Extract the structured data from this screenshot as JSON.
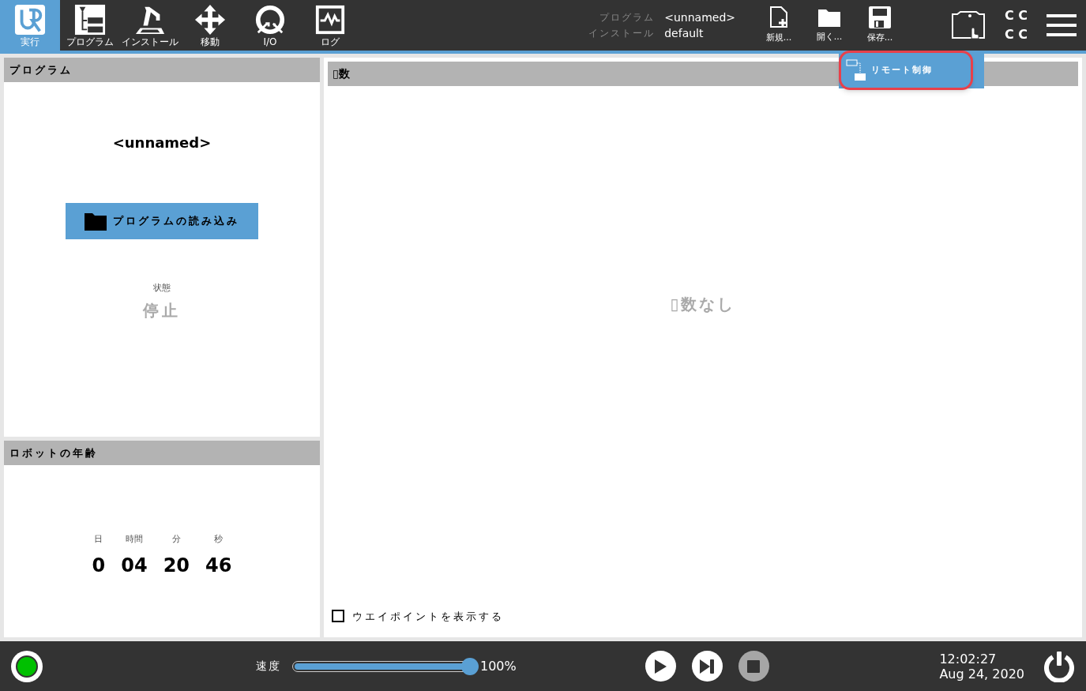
{
  "nav": [
    {
      "kind": "logo",
      "label": "実行",
      "selected": true
    },
    {
      "kind": "program",
      "label": "プログラム",
      "selected": false
    },
    {
      "kind": "arm",
      "label": "インストール",
      "selected": false
    },
    {
      "kind": "move",
      "label": "移動",
      "selected": false
    },
    {
      "kind": "io",
      "label": "I/O",
      "selected": false
    },
    {
      "kind": "log",
      "label": "ログ",
      "selected": false
    }
  ],
  "program_info": {
    "program_label": "プログラム",
    "program_value": "<unnamed>",
    "installation_label": "インストール",
    "installation_value": "default"
  },
  "file_buttons": [
    {
      "kind": "new",
      "label": "新規..."
    },
    {
      "kind": "open",
      "label": "開く..."
    },
    {
      "kind": "save",
      "label": "保存..."
    }
  ],
  "remote_menu": {
    "label": "リモート制御"
  },
  "top_right_text": [
    "C C",
    "C C"
  ],
  "program_panel": {
    "title": "プログラム",
    "name": "<unnamed>",
    "load_button": "プログラムの読み込み",
    "status_label": "状態",
    "status_value": "停止"
  },
  "age_panel": {
    "title": "ロボットの年齢",
    "units": [
      {
        "label": "日",
        "value": "0"
      },
      {
        "label": "時間",
        "value": "04"
      },
      {
        "label": "分",
        "value": "20"
      },
      {
        "label": "秒",
        "value": "46"
      }
    ]
  },
  "variables_panel": {
    "title": "▯数",
    "empty_text": "▯数なし",
    "show_waypoints": {
      "label": "ウエイポイントを表示する",
      "checked": false
    }
  },
  "bottom": {
    "speed_label": "速度",
    "speed": {
      "level": 1
    },
    "speed_reading": "100%",
    "controls": [
      {
        "kind": "play",
        "disabled": false
      },
      {
        "kind": "step",
        "disabled": false
      },
      {
        "kind": "stop",
        "disabled": true
      }
    ],
    "time": "12:02:27",
    "date": "Aug 24, 2020"
  }
}
